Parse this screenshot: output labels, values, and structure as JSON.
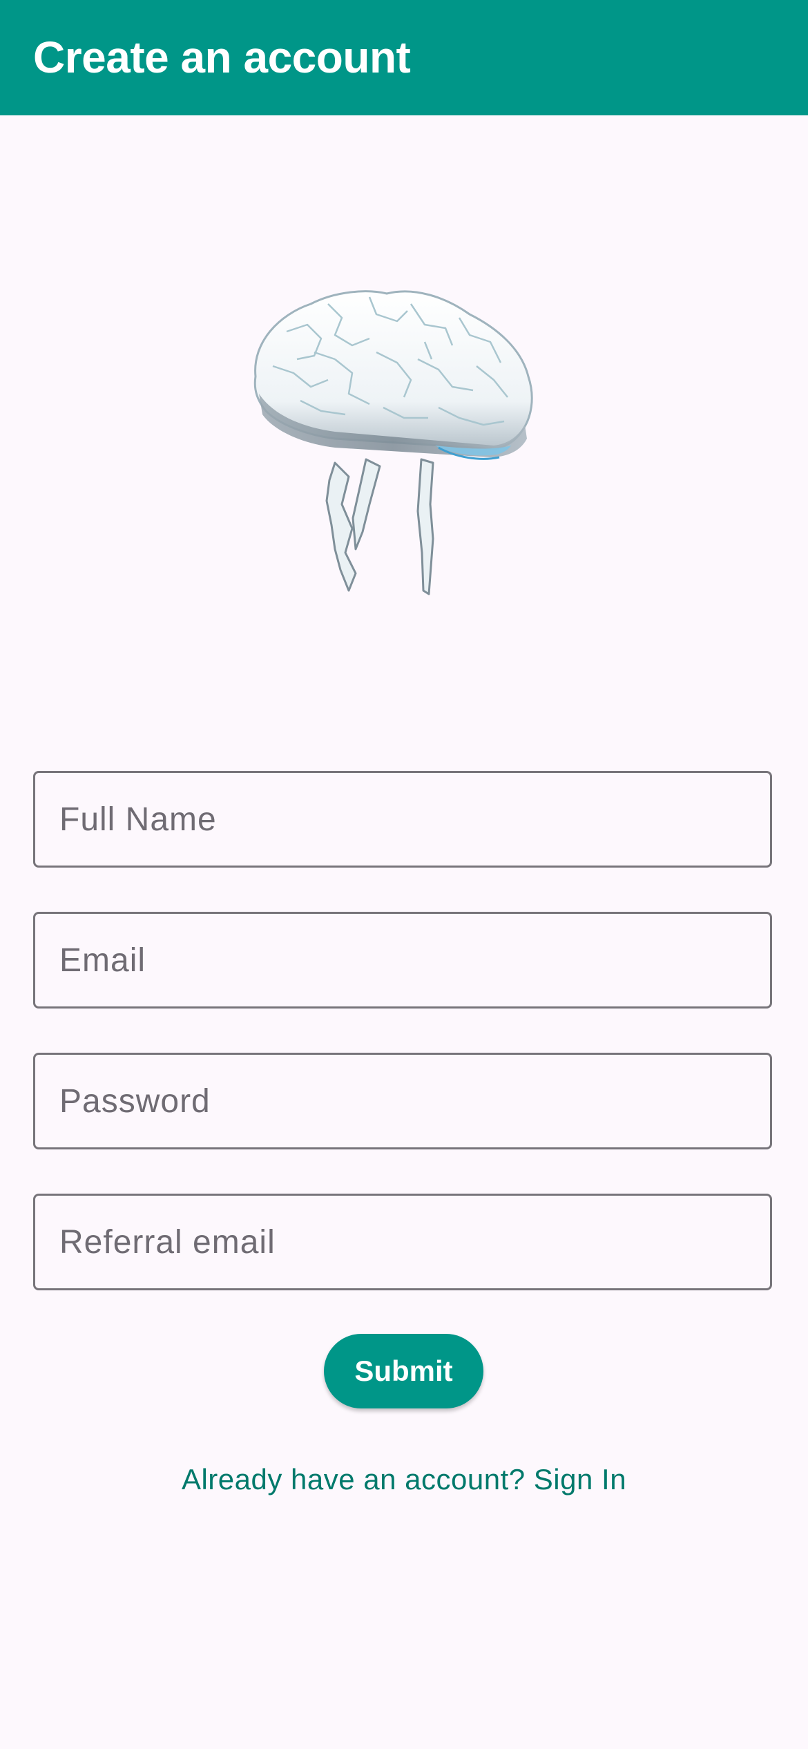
{
  "app_bar": {
    "title": "Create an account",
    "color": "#009688"
  },
  "logo": {
    "icon": "brain-icon"
  },
  "form": {
    "full_name": {
      "placeholder": "Full Name",
      "value": ""
    },
    "email": {
      "placeholder": "Email",
      "value": ""
    },
    "password": {
      "placeholder": "Password",
      "value": ""
    },
    "referral_email": {
      "placeholder": "Referral email",
      "value": ""
    }
  },
  "submit": {
    "label": "Submit"
  },
  "signin_link": {
    "label": "Already have an account? Sign In",
    "color": "#00796b"
  }
}
